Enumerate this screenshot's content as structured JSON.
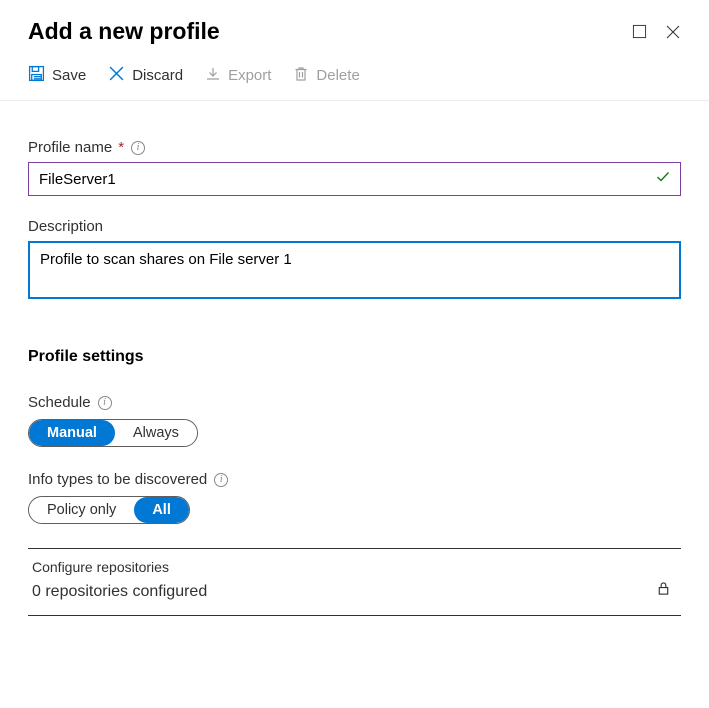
{
  "header": {
    "title": "Add a new profile"
  },
  "toolbar": {
    "save": "Save",
    "discard": "Discard",
    "export": "Export",
    "delete": "Delete"
  },
  "fields": {
    "profile_name": {
      "label": "Profile name",
      "value": "FileServer1"
    },
    "description": {
      "label": "Description",
      "value": "Profile to scan shares on File server 1"
    }
  },
  "settings": {
    "title": "Profile settings",
    "schedule": {
      "label": "Schedule",
      "options": [
        "Manual",
        "Always"
      ],
      "selected": "Manual"
    },
    "info_types": {
      "label": "Info types to be discovered",
      "options": [
        "Policy only",
        "All"
      ],
      "selected": "All"
    }
  },
  "repos": {
    "title": "Configure repositories",
    "count_text": "0 repositories configured"
  }
}
